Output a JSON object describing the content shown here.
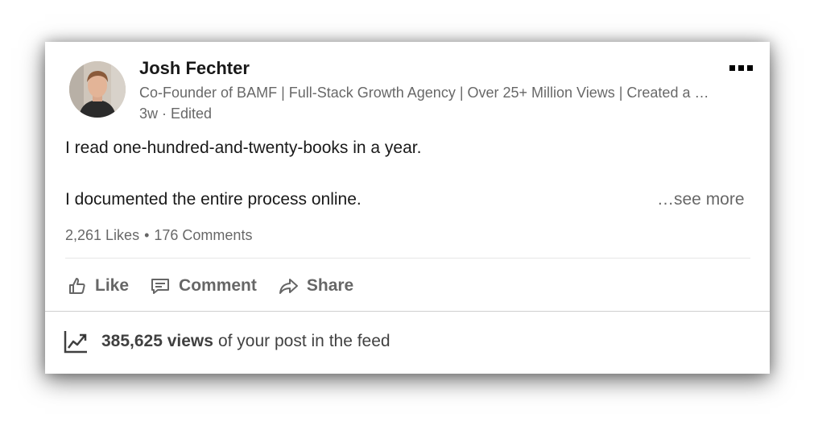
{
  "author": {
    "name": "Josh Fechter",
    "headline": "Co-Founder of BAMF | Full-Stack Growth Agency | Over 25+ Million Views | Created a …",
    "meta": "3w · Edited"
  },
  "post": {
    "line1": "I read one-hundred-and-twenty-books in a year.",
    "line2": "I documented the entire process online.",
    "see_more": "…see more"
  },
  "social": {
    "likes": "2,261 Likes",
    "separator": "•",
    "comments": "176 Comments"
  },
  "actions": {
    "like": "Like",
    "comment": "Comment",
    "share": "Share"
  },
  "analytics": {
    "views": "385,625 views",
    "suffix": "of your post in the feed"
  },
  "icons": {
    "more": "more-options-icon",
    "like": "thumbs-up-icon",
    "comment": "comment-bubble-icon",
    "share": "share-arrow-icon",
    "analytics": "trending-chart-icon"
  }
}
